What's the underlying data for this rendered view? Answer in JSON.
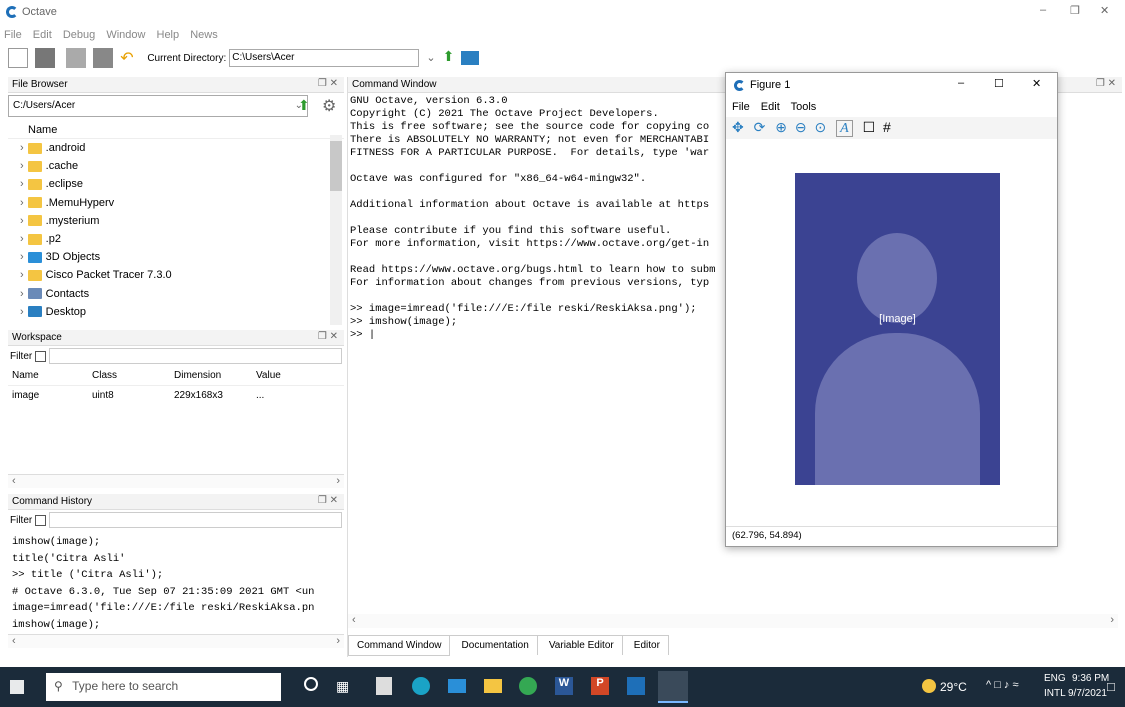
{
  "app": {
    "title": "Octave"
  },
  "menu": [
    "File",
    "Edit",
    "Debug",
    "Window",
    "Help",
    "News"
  ],
  "toolbar": {
    "cwd_label": "Current Directory:",
    "cwd_value": "C:\\Users\\Acer"
  },
  "file_browser": {
    "title": "File Browser",
    "path": "C:/Users/Acer",
    "column": "Name",
    "items": [
      ".android",
      ".cache",
      ".eclipse",
      ".MemuHyperv",
      ".mysterium",
      ".p2",
      "3D Objects",
      "Cisco Packet Tracer 7.3.0",
      "Contacts",
      "Desktop"
    ]
  },
  "workspace": {
    "title": "Workspace",
    "filter_label": "Filter",
    "headers": [
      "Name",
      "Class",
      "Dimension",
      "Value"
    ],
    "rows": [
      [
        "image",
        "uint8",
        "229x168x3",
        "..."
      ]
    ]
  },
  "history": {
    "title": "Command History",
    "filter_label": "Filter",
    "lines": [
      "imshow(image);",
      "title('Citra Asli'",
      ">> title ('Citra Asli');",
      "# Octave 6.3.0, Tue Sep 07 21:35:09 2021 GMT <un",
      "image=imread('file:///E:/file reski/ReskiAksa.pn",
      "imshow(image);"
    ]
  },
  "command_window": {
    "title": "Command Window",
    "lines": [
      "GNU Octave, version 6.3.0",
      "Copyright (C) 2021 The Octave Project Developers.",
      "This is free software; see the source code for copying co",
      "There is ABSOLUTELY NO WARRANTY; not even for MERCHANTABI",
      "FITNESS FOR A PARTICULAR PURPOSE.  For details, type 'war",
      "",
      "Octave was configured for \"x86_64-w64-mingw32\".",
      "",
      "Additional information about Octave is available at https",
      "",
      "Please contribute if you find this software useful.",
      "For more information, visit https://www.octave.org/get-in",
      "",
      "Read https://www.octave.org/bugs.html to learn how to subm",
      "For information about changes from previous versions, typ",
      "",
      ">> image=imread('file:///E:/file reski/ReskiAksa.png');",
      ">> imshow(image);",
      ">> |"
    ],
    "tabs": [
      "Command Window",
      "Documentation",
      "Variable Editor",
      "Editor"
    ]
  },
  "figure": {
    "title": "Figure 1",
    "menu": [
      "File",
      "Edit",
      "Tools"
    ],
    "coords": "(62.796, 54.894)",
    "image_note": "[Image]"
  },
  "taskbar": {
    "search": "Type here to search",
    "weather": "29°C",
    "lang": "ENG",
    "lang2": "INTL",
    "time": "9:36 PM",
    "date": "9/7/2021"
  }
}
